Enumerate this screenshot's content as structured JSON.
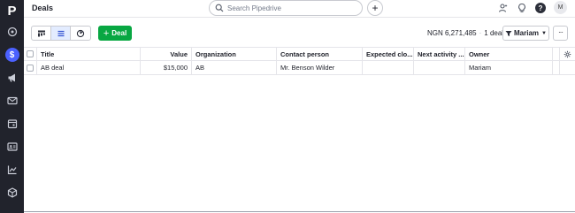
{
  "app": {
    "page_title": "Deals",
    "search_placeholder": "Search Pipedrive",
    "user_initial": "M",
    "help_label": "?",
    "logo_letter": "P"
  },
  "sidebar": {
    "items": [
      {
        "icon": "target-icon"
      },
      {
        "icon": "dollar-icon",
        "active": true
      },
      {
        "icon": "megaphone-icon"
      },
      {
        "icon": "mail-icon"
      },
      {
        "icon": "calendar-icon"
      },
      {
        "icon": "contacts-card-icon"
      },
      {
        "icon": "chart-icon"
      },
      {
        "icon": "box-icon"
      }
    ]
  },
  "toolbar": {
    "add_deal_label": "Deal",
    "summary_amount": "NGN 6,271,485",
    "summary_separator": "·",
    "summary_count": "1 deal",
    "owner_filter_label": "Mariam",
    "more_label": "···"
  },
  "table": {
    "columns": [
      "Title",
      "Value",
      "Organization",
      "Contact person",
      "Expected clo...",
      "Next activity ...",
      "Owner"
    ],
    "rows": [
      {
        "title": "AB deal",
        "value": "$15,000",
        "organization": "AB",
        "contact": "Mr. Benson Wilder",
        "expected_close": "",
        "next_activity": "",
        "owner": "Mariam"
      }
    ]
  },
  "colors": {
    "sidebar_bg": "#21232c",
    "accent": "#4b61ff",
    "add_button": "#08a742"
  }
}
